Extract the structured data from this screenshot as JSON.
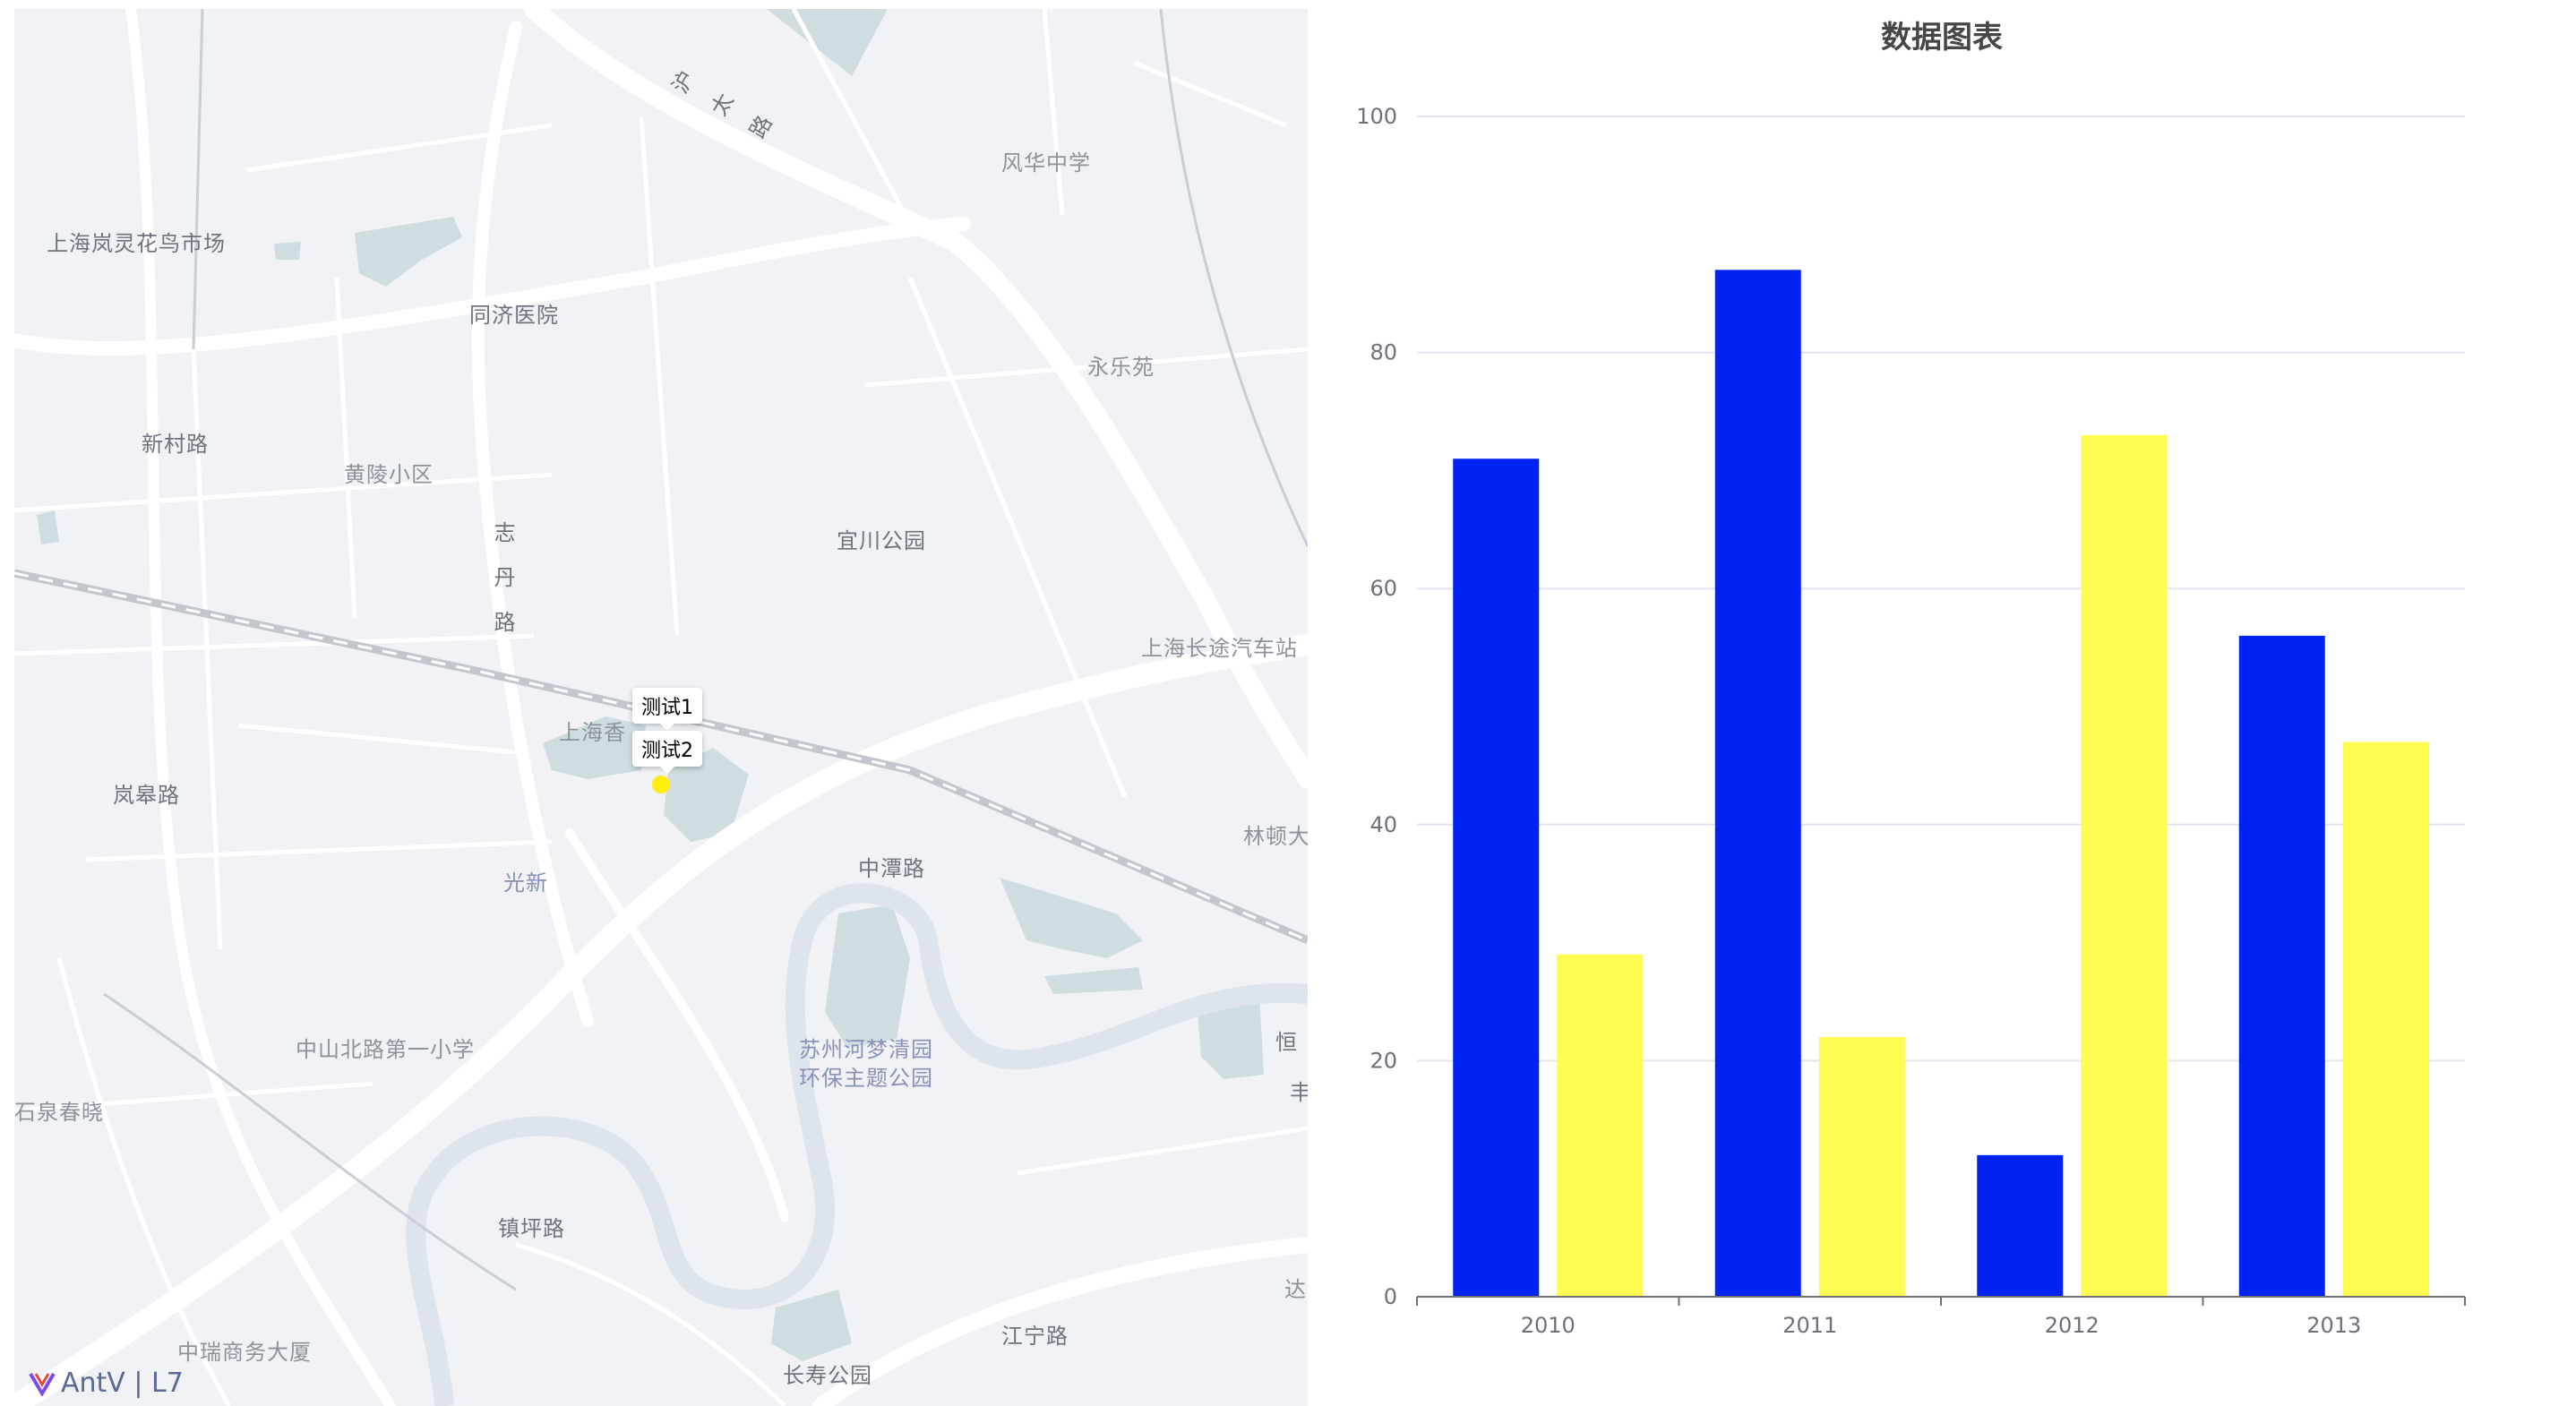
{
  "map": {
    "popups": [
      "测试1",
      "测试2"
    ],
    "logo_text": "AntV | L7",
    "labels": [
      {
        "id": "huaniao",
        "text": "上海岚灵花鸟市场",
        "cls": "dark"
      },
      {
        "id": "hutai",
        "text": "沪太路",
        "cls": "vertical"
      },
      {
        "id": "fenghua",
        "text": "风华中学",
        "cls": ""
      },
      {
        "id": "tongji",
        "text": "同济医院",
        "cls": "dark"
      },
      {
        "id": "yongle",
        "text": "永乐苑",
        "cls": ""
      },
      {
        "id": "xincun",
        "text": "新村路",
        "cls": "dark"
      },
      {
        "id": "huangling",
        "text": "黄陵小区",
        "cls": ""
      },
      {
        "id": "zhidan",
        "text": "志丹路",
        "cls": "vertical"
      },
      {
        "id": "yichuan",
        "text": "宜川公园",
        "cls": "dark"
      },
      {
        "id": "changtu",
        "text": "上海长途汽车站",
        "cls": ""
      },
      {
        "id": "xiangshu",
        "text": "上海香",
        "cls": ""
      },
      {
        "id": "langao",
        "text": "岚皋路",
        "cls": "dark"
      },
      {
        "id": "linton",
        "text": "林顿大",
        "cls": ""
      },
      {
        "id": "guangxin",
        "text": "光新",
        "cls": "blue"
      },
      {
        "id": "zhongtan",
        "text": "中潭路",
        "cls": "dark"
      },
      {
        "id": "zhongshan",
        "text": "中山北路第一小学",
        "cls": ""
      },
      {
        "id": "suzhouhe",
        "text": "苏州河梦清园",
        "cls": "blue"
      },
      {
        "id": "huanbao",
        "text": "环保主题公园",
        "cls": "blue"
      },
      {
        "id": "heng",
        "text": "恒",
        "cls": "dark"
      },
      {
        "id": "feng",
        "text": "丰",
        "cls": "dark"
      },
      {
        "id": "shiquan",
        "text": "石泉春晓",
        "cls": ""
      },
      {
        "id": "zhenping",
        "text": "镇坪路",
        "cls": "dark"
      },
      {
        "id": "da",
        "text": "达",
        "cls": ""
      },
      {
        "id": "zhongrui",
        "text": "中瑞商务大厦",
        "cls": ""
      },
      {
        "id": "jiangning",
        "text": "江宁路",
        "cls": "dark"
      },
      {
        "id": "changshou",
        "text": "长寿公园",
        "cls": "dark"
      }
    ]
  },
  "chart_data": {
    "type": "bar",
    "title": "数据图表",
    "categories": [
      "2010",
      "2011",
      "2012",
      "2013"
    ],
    "series": [
      {
        "color": "#0022f2",
        "values": [
          71,
          87,
          12,
          56
        ]
      },
      {
        "color": "#fffc52",
        "values": [
          29,
          22,
          73,
          47
        ]
      }
    ],
    "ylim": [
      0,
      100
    ],
    "yticks": [
      0,
      20,
      40,
      60,
      80,
      100
    ],
    "grid": true,
    "legend": "none"
  }
}
